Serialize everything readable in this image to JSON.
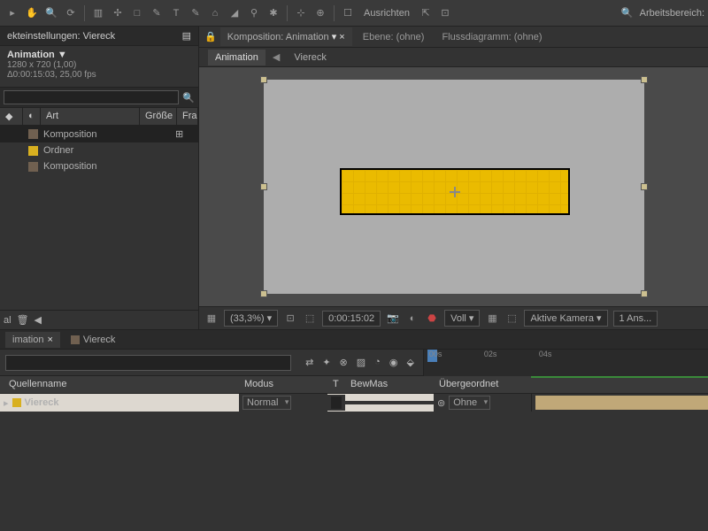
{
  "toolbar": {
    "align_label": "Ausrichten",
    "workspace_label": "Arbeitsbereich:"
  },
  "project_panel": {
    "tab": "ekteinstellungen: Viereck",
    "comp_title": "Animation ▼",
    "comp_res": "1280 x 720 (1,00)",
    "comp_dur": "Δ0:00:15:03, 25,00 fps",
    "col_type": "Art",
    "col_size": "Größe",
    "col_fra": "Fra",
    "items": [
      {
        "label": "Komposition",
        "class": "sw-comp",
        "sel": true
      },
      {
        "label": "Ordner",
        "class": "sw-folder",
        "sel": false
      },
      {
        "label": "Komposition",
        "class": "sw-comp",
        "sel": false
      }
    ],
    "bottom_al": "al"
  },
  "viewer": {
    "tab_comp_prefix": "Komposition:",
    "tab_comp_name": "Animation",
    "tab_layer": "Ebene: (ohne)",
    "tab_flow": "Flussdiagramm: (ohne)",
    "bc_active": "Animation",
    "bc_second": "Viereck",
    "zoom": "(33,3%)",
    "time": "0:00:15:02",
    "view_mode": "Voll",
    "camera": "Aktive Kamera",
    "views": "1 Ans..."
  },
  "timeline": {
    "tab1": "imation",
    "tab2": "Viereck",
    "col_source": "Quellenname",
    "col_mode": "Modus",
    "col_t": "T",
    "col_bewmas": "BewMas",
    "col_parent": "Übergeordnet",
    "layer_name": "Viereck",
    "mode_value": "Normal",
    "parent_value": "Ohne",
    "ruler": [
      "00s",
      "02s",
      "04s"
    ]
  }
}
